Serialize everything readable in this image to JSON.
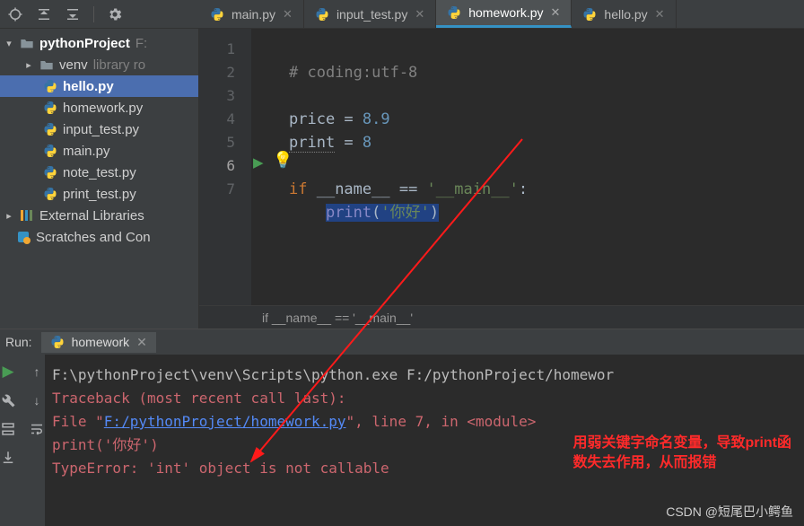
{
  "toolbar_icons": [
    "target-icon",
    "collapse-icon",
    "expand-icon",
    "divider",
    "gear-icon"
  ],
  "project": {
    "root": {
      "label": "pythonProject",
      "suffix": "F:"
    },
    "venv": {
      "label": "venv",
      "suffix": "library ro"
    },
    "files": [
      "hello.py",
      "homework.py",
      "input_test.py",
      "main.py",
      "note_test.py",
      "print_test.py"
    ],
    "external": "External Libraries",
    "scratches": "Scratches and Con"
  },
  "tabs": [
    {
      "label": "main.py",
      "active": false
    },
    {
      "label": "input_test.py",
      "active": false
    },
    {
      "label": "homework.py",
      "active": true
    },
    {
      "label": "hello.py",
      "active": false
    }
  ],
  "code": {
    "l1": "# coding:utf-8",
    "l3_a": "price = ",
    "l3_b": "8.9",
    "l4_a": "print",
    "l4_b": " = ",
    "l4_c": "8",
    "l6_a": "if",
    "l6_b": " __name__ == ",
    "l6_c": "'__main__'",
    "l6_d": ":",
    "l7_a": "print",
    "l7_b": "(",
    "l7_c": "'你好'",
    "l7_d": ")",
    "lines": [
      "1",
      "2",
      "3",
      "4",
      "5",
      "6",
      "7"
    ]
  },
  "breadcrumb": "if __name__ == '__main__'",
  "run": {
    "title": "Run:",
    "tab": "homework",
    "cmd": "F:\\pythonProject\\venv\\Scripts\\python.exe F:/pythonProject/homewor",
    "trace": "Traceback (most recent call last):",
    "file_a": "  File \"",
    "file_link": "F:/pythonProject/homework.py",
    "file_b": "\", line 7, in <module>",
    "src": "    print('你好')",
    "err": "TypeError: 'int' object is not callable"
  },
  "annotation": {
    "l1": "用弱关键字命名变量，导致print函",
    "l2": "数失去作用，从而报错"
  },
  "watermark": "CSDN @短尾巴小鳄鱼"
}
